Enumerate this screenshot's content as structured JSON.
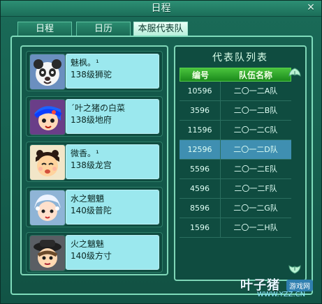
{
  "window": {
    "title": "日程",
    "close_icon": "close-icon"
  },
  "tabs": [
    {
      "label": "日程",
      "active": false
    },
    {
      "label": "日历",
      "active": false
    },
    {
      "label": "本服代表队",
      "active": true
    }
  ],
  "members": [
    {
      "name": "魅枫。¹",
      "desc": "138级狮驼",
      "avatar": "panda-avatar"
    },
    {
      "name": "ˊ叶之猪の白菜",
      "desc": "138级地府",
      "avatar": "blue-hair-avatar"
    },
    {
      "name": "微香。¹",
      "desc": "138级龙宫",
      "avatar": "girl-avatar"
    },
    {
      "name": "水之魍魉",
      "desc": "140级普陀",
      "avatar": "white-hair-avatar"
    },
    {
      "name": "火之魑魅",
      "desc": "140级方寸",
      "avatar": "hat-avatar"
    }
  ],
  "teams_panel": {
    "title": "代表队列表",
    "headers": [
      "编号",
      "队伍名称"
    ],
    "rows": [
      {
        "id": "10596",
        "name": "二〇一二A队",
        "selected": false
      },
      {
        "id": "3596",
        "name": "二〇一二B队",
        "selected": false
      },
      {
        "id": "11596",
        "name": "二〇一二C队",
        "selected": false
      },
      {
        "id": "12596",
        "name": "二〇一二D队",
        "selected": true
      },
      {
        "id": "5596",
        "name": "二〇一二E队",
        "selected": false
      },
      {
        "id": "4596",
        "name": "二〇一二F队",
        "selected": false
      },
      {
        "id": "8596",
        "name": "二〇一二G队",
        "selected": false
      },
      {
        "id": "1596",
        "name": "二〇一二H队",
        "selected": false
      }
    ]
  },
  "watermark": {
    "main": "叶子猪",
    "badge": "游戏网",
    "url": "WWW.YZZ.CN"
  }
}
